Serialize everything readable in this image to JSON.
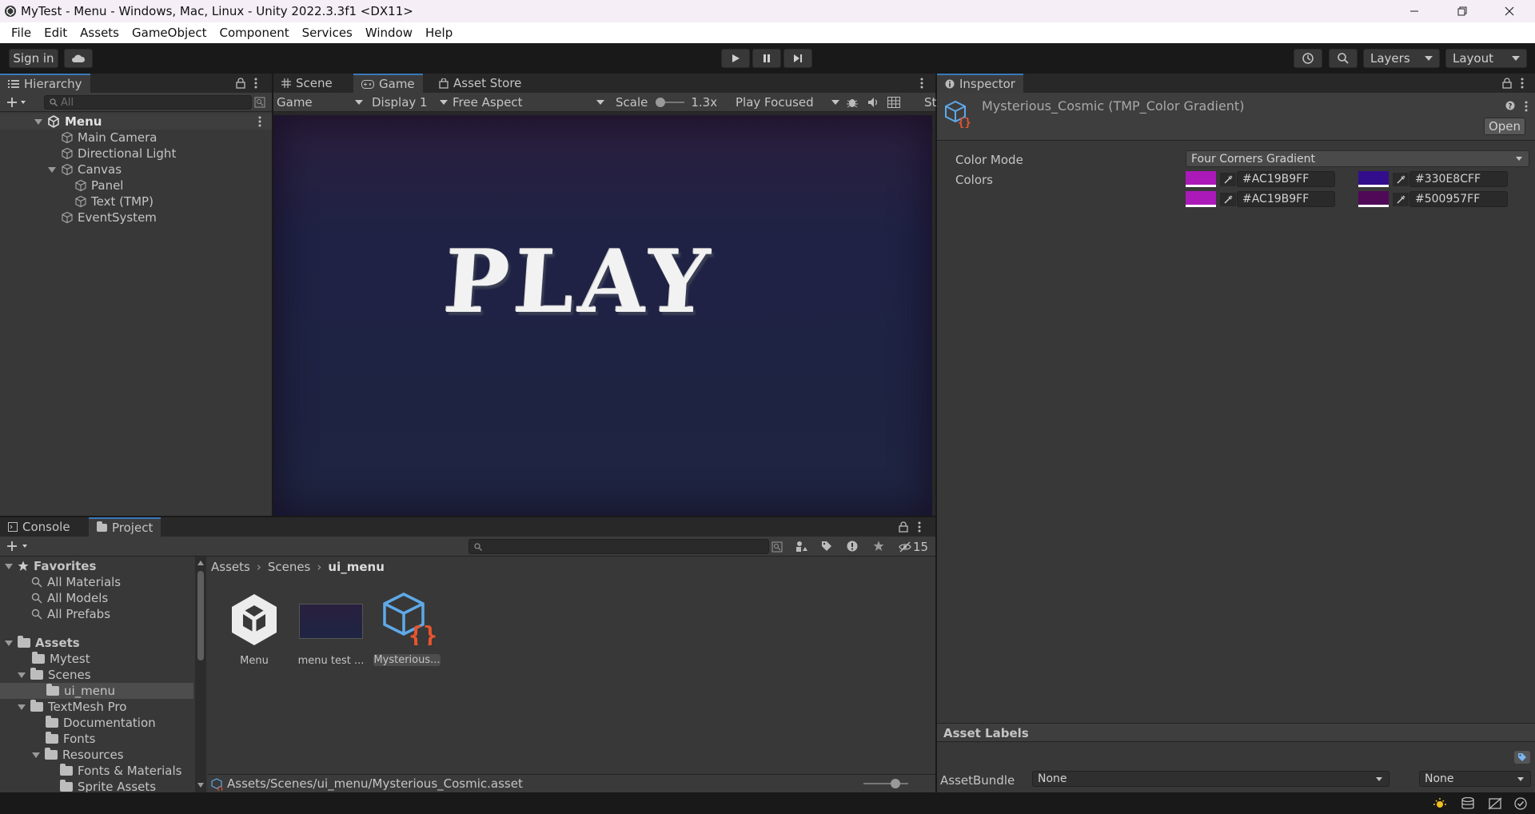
{
  "window": {
    "title": "MyTest - Menu - Windows, Mac, Linux - Unity 2022.3.3f1 <DX11>"
  },
  "menubar": [
    "File",
    "Edit",
    "Assets",
    "GameObject",
    "Component",
    "Services",
    "Window",
    "Help"
  ],
  "toolbar": {
    "sign_in": "Sign in",
    "layers": "Layers",
    "layout": "Layout"
  },
  "hierarchy": {
    "tab": "Hierarchy",
    "search_placeholder": "All",
    "scene": "Menu",
    "items": [
      "Main Camera",
      "Directional Light",
      "Canvas",
      "Panel",
      "Text (TMP)",
      "EventSystem"
    ]
  },
  "game_view": {
    "tabs": [
      "Scene",
      "Game",
      "Asset Store"
    ],
    "view_mode": "Game",
    "display": "Display 1",
    "aspect": "Free Aspect",
    "scale_label": "Scale",
    "scale_value": "1.3x",
    "play_mode": "Play Focused",
    "stats_partial": "St",
    "play_text": "PLAY",
    "bg_top": "#2b1f3d",
    "bg_bottom": "#1e2440"
  },
  "inspector": {
    "tab": "Inspector",
    "asset_title": "Mysterious_Cosmic (TMP_Color Gradient)",
    "open_button": "Open",
    "color_mode_label": "Color Mode",
    "color_mode_value": "Four Corners Gradient",
    "colors_label": "Colors",
    "colors": [
      {
        "hex": "#AC19B9FF",
        "swatch": "#ac19b9"
      },
      {
        "hex": "#330E8CFF",
        "swatch": "#330e8c"
      },
      {
        "hex": "#AC19B9FF",
        "swatch": "#ac19b9"
      },
      {
        "hex": "#500957FF",
        "swatch": "#500957"
      }
    ],
    "asset_labels": "Asset Labels",
    "assetbundle_label": "AssetBundle",
    "assetbundle_value": "None",
    "assetbundle_variant": "None"
  },
  "bottom": {
    "tabs": [
      "Console",
      "Project"
    ],
    "hidden_count": "15",
    "favorites_label": "Favorites",
    "favorites": [
      "All Materials",
      "All Models",
      "All Prefabs"
    ],
    "assets_label": "Assets",
    "tree": [
      "Mytest",
      "Scenes",
      "ui_menu",
      "TextMesh Pro",
      "Documentation",
      "Fonts",
      "Resources",
      "Fonts & Materials",
      "Sprite Assets"
    ],
    "breadcrumb": [
      "Assets",
      "Scenes",
      "ui_menu"
    ],
    "files": [
      "Menu",
      "menu test ...",
      "Mysterious..."
    ],
    "status_path": "Assets/Scenes/ui_menu/Mysterious_Cosmic.asset"
  },
  "colors": {
    "accent": "#3a79bb",
    "selected": "#2c5d87"
  }
}
